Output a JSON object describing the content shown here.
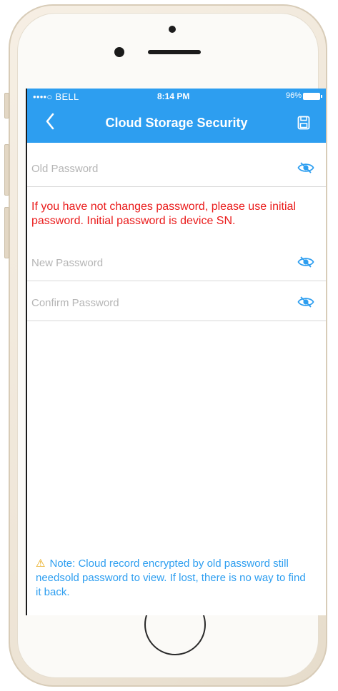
{
  "status_bar": {
    "carrier": "••••○ BELL",
    "time": "8:14 PM",
    "battery": "96%"
  },
  "header": {
    "title": "Cloud Storage Security",
    "back_icon": "chevron-left-icon",
    "save_icon": "floppy-disk-icon"
  },
  "form": {
    "old_password_placeholder": "Old Password",
    "hint": "If you have not changes password, please use initial password. Initial password is device SN.",
    "new_password_placeholder": "New Password",
    "confirm_password_placeholder": "Confirm Password",
    "eye_icon": "eye-hidden-icon"
  },
  "note": {
    "icon": "warning-triangle-icon",
    "text": "Note: Cloud record encrypted by old password still needsold password to view. If lost, there is no way to find it back."
  },
  "colors": {
    "accent": "#2d9ef0",
    "warning_text": "#ea1b1b",
    "note_icon": "#e6a100"
  }
}
